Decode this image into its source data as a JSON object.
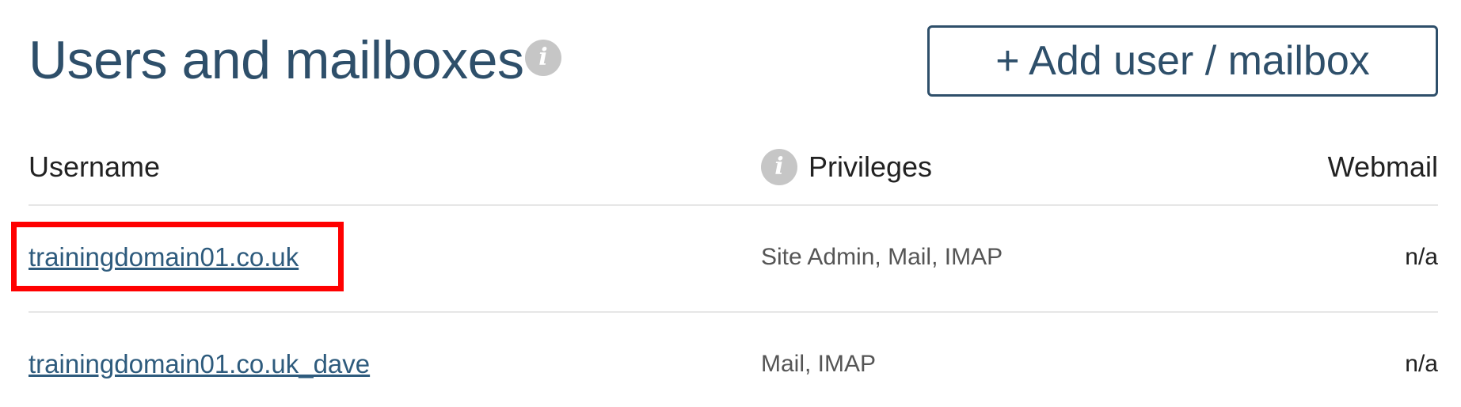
{
  "header": {
    "title": "Users and mailboxes",
    "title_info_icon": "info-icon",
    "add_button_label": "+ Add user / mailbox"
  },
  "table": {
    "columns": {
      "username": "Username",
      "privileges": "Privileges",
      "privileges_info_icon": "info-icon",
      "webmail": "Webmail"
    },
    "rows": [
      {
        "username": "trainingdomain01.co.uk",
        "privileges": "Site Admin, Mail, IMAP",
        "webmail": "n/a",
        "highlighted": true
      },
      {
        "username": "trainingdomain01.co.uk_dave",
        "privileges": "Mail, IMAP",
        "webmail": "n/a",
        "highlighted": false
      }
    ]
  },
  "colors": {
    "brand": "#2e4f6a",
    "link": "#2e5b7d",
    "highlight": "#ff0000",
    "icon_gray": "#c6c6c6"
  }
}
